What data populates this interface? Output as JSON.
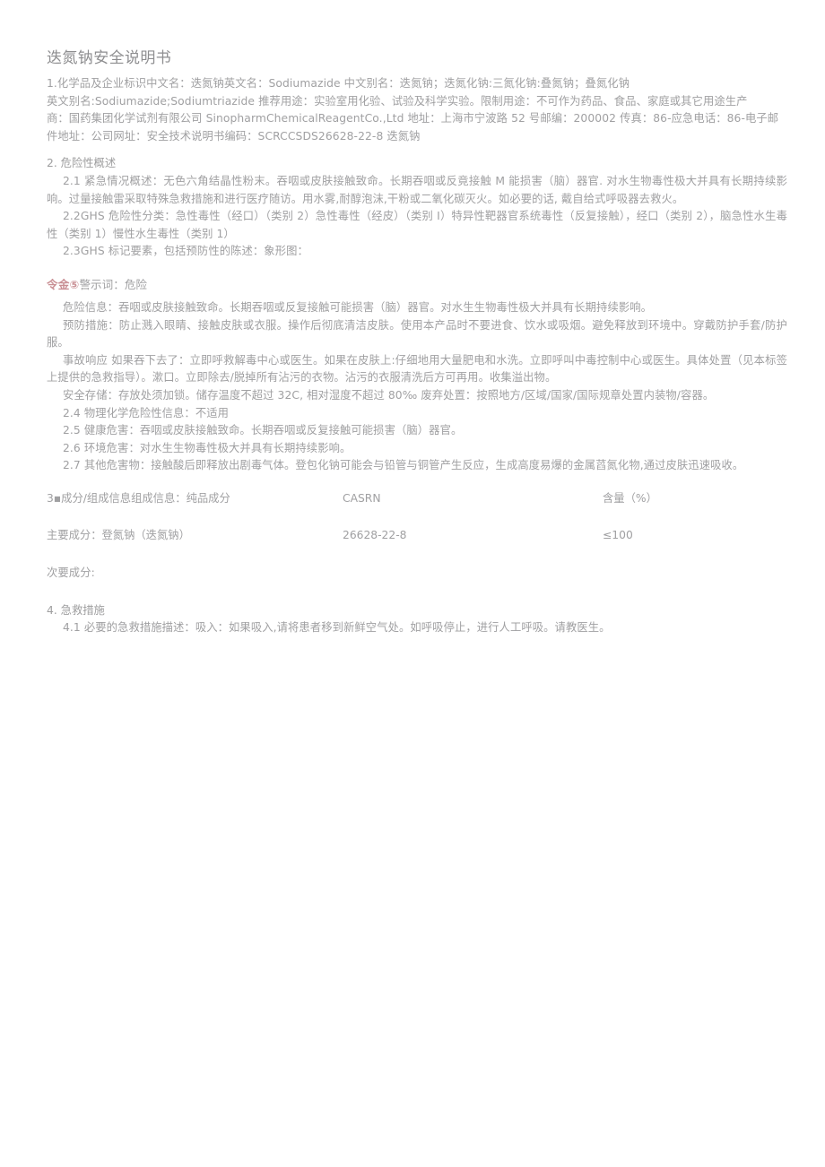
{
  "document": {
    "title": "迭氮钠安全说明书"
  },
  "section1": {
    "line1": "1.化学品及企业标识中文名：迭氮钠英文名：Sodiumazide 中文别名：迭氮钠；迭氮化钠:三氮化钠:叠氮钠；叠氮化钠",
    "line2": "英文别名:Sodiumazide;Sodiumtriazide 推荐用途：实验室用化验、试验及科学实验。限制用途：不可作为药品、食品、家庭或其它用途生产",
    "line3": "商：国药集团化学试剂有限公司 SinopharmChemicalReagentCo.,Ltd 地址：上海市宁波路 52 号邮编：200002 传真：86-应急电话：86-电子邮",
    "line4": "件地址：公司网址：安全技术说明书编码：SCRCCSDS26628-22-8 迭氮钠"
  },
  "section2": {
    "heading": "2. 危险性概述",
    "item21": "2.1 紧急情况概述：无色六角结晶性粉末。吞咽或皮肤接触致命。长期吞咽或反竟接触 M 能损害（脑）器官. 对水生物毒性极大并具有长期持续影响。过量接触雷采取特殊急救措施和进行医疗随访。用水雾,耐醇泡沫,干粉或二氧化碳灭火。如必要的话, 戴自给式呼吸器去救火。",
    "item22": "2.2GHS 危险性分类：急性毒性（经口）（类别 2）急性毒性（经皮）（类别 I）特异性靶器官系统毒性（反复接触），经口（类别 2），脑急性水生毒性（类别 1）慢性水生毒性（类别 1）",
    "item23": "2.3GHS 标记要素，包括预防性的陈述：象形图：",
    "warn_symbol": "令金⑤",
    "warn_word": "警示词：危险",
    "hazard_info": "危险信息：吞咽或皮肤接触致命。长期吞咽或反复接触可能损害（脑）器官。对水生生物毒性极大并具有长期持续影响。",
    "hazard_info_bold": "长期吞咽",
    "precaution": "预防措施：防止溅入眼睛、接触皮肤或衣服。操作后彻底清洁皮肤。使用本产品时不要进食、饮水或吸烟。避免释放到环境中。穿戴防护手套/防护服。",
    "response": "事故响应 如果吞下去了：立即呼救解毒中心或医生。如果在皮肤上:仔细地用大量肥电和水洗。立即呼叫中毒控制中心或医生。具体处置（见本标签上提供的急救指导）。漱口。立即除去/脱掉所有沾污的衣物。沾污的衣服清洗后方可再用。收集溢出物。",
    "response_serif": "衣物",
    "storage": "安全存储：存放处须加锁。储存温度不超过 32C, 相对湿度不超过 80‰ 废弃处置：按照地方/区域/国家/国际规章处置内装物/容器。",
    "item24": "2.4 物理化学危险性信息：不适用",
    "item25": "2.5 健康危害：吞咽或皮肤接触致命。长期吞咽或反复接触可能损害（脑）器官。",
    "item26": "2.6 环境危害：对水生生物毒性极大并具有长期持续影响。",
    "item27": "2.7 其他危害物：接触酸后即释放出剧毒气体。登包化钠可能会与铅管与铜管产生反应，生成高度易爆的金属蓞氮化物,通过皮肤迅速吸收。"
  },
  "section3": {
    "header_name": "3▪成分/组成信息组成信息：纯品成分",
    "header_cas": "CASRN",
    "header_conc": "含量（%）",
    "rows": [
      {
        "name": "主要成分：登氮钠（迭氮钠）",
        "cas": "26628-22-8",
        "conc": "≤100"
      }
    ],
    "minor": "次要成分:"
  },
  "section4": {
    "heading": "4. 急救措施",
    "item41": "4.1 必要的急救措施描述：吸入：如果吸入,请将患者移到新鲜空气处。如呼吸停止，进行人工呼吸。请教医生。"
  },
  "colors": {
    "body_text": "#a0a0a2",
    "title_text": "#8e8e90",
    "warn_accent": "#c98f94",
    "background": "#ffffff"
  }
}
